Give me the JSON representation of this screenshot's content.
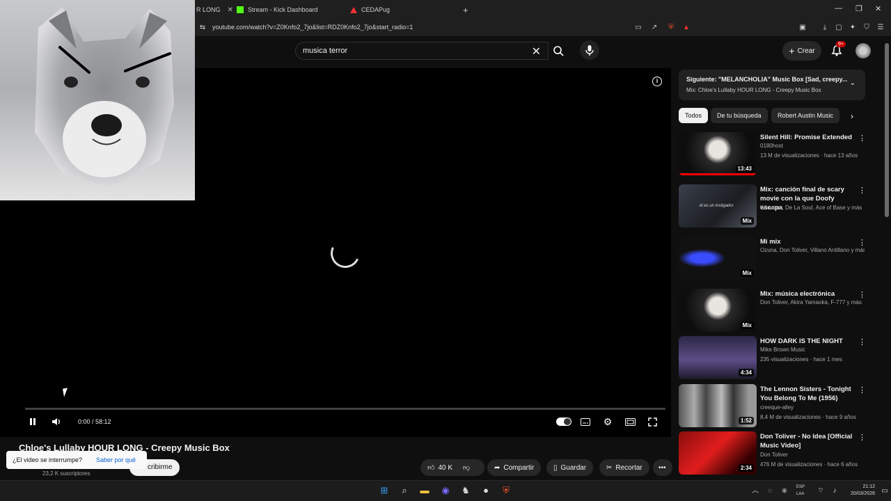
{
  "browser": {
    "tabs": [
      {
        "label": "R LONG"
      },
      {
        "label": "Stream - Kick Dashboard"
      },
      {
        "label": "CEDAPug"
      }
    ],
    "url": "youtube.com/watch?v=Z0Knfo2_7jo&list=RDZ0Knfo2_7jo&start_radio=1"
  },
  "header": {
    "search_value": "musica terror",
    "create_label": "Crear",
    "notif_count": "9+"
  },
  "player": {
    "time": "0:00 / 58:12"
  },
  "video": {
    "title": "Chloe's Lullaby HOUR LONG - Creepy Music Box",
    "subscribers": "23,2 K suscriptores",
    "subscribe_label": "cribirme",
    "toast_question": "¿El video se interrumpe?",
    "toast_link": "Saber por qué",
    "likes": "40 K",
    "share_label": "Compartir",
    "save_label": "Guardar",
    "clip_label": "Recortar"
  },
  "up_next": {
    "title": "Siguiente: \"MELANCHOLIA\" Music Box [Sad, creepy...",
    "subtitle": "Mix: Chloe's Lullaby HOUR LONG - Creepy Music Box"
  },
  "chips": [
    "Todos",
    "De tu búsqueda",
    "Robert Austin Music"
  ],
  "recommendations": [
    {
      "title": "Silent Hill: Promise Extended",
      "channel": "0180host",
      "meta": "13 M de visualizaciones · hace 13 años",
      "badge": "13:43"
    },
    {
      "title": "Mix: canción final de scary movie con la que Doofy escapa",
      "channel": "Wheatus, De La Soul, Ace of Base y más",
      "meta": "",
      "badge": "Mix",
      "thumb_text": "él es un instigador"
    },
    {
      "title": "Mi mix",
      "channel": "Ozuna, Don Toliver, Villano Antillano y más",
      "meta": "",
      "badge": "Mix"
    },
    {
      "title": "Mix: música electrónica",
      "channel": "Don Toliver, Akira Yamaoka, F-777 y más",
      "meta": "",
      "badge": "Mix"
    },
    {
      "title": "HOW DARK IS THE NIGHT",
      "channel": "Mike Brown Music",
      "meta": "235 visualizaciones · hace 1 mes",
      "badge": "4:34"
    },
    {
      "title": "The Lennon Sisters - Tonight You Belong To Me (1956)",
      "channel": "creeque-alley",
      "meta": "8,4 M de visualizaciones · hace 9 años",
      "badge": "1:52"
    },
    {
      "title": "Don Toliver - No Idea [Official Music Video]",
      "channel": "Don Toliver",
      "meta": "476 M de visualizaciones · hace 6 años",
      "badge": "2:34"
    }
  ],
  "taskbar": {
    "lang_line1": "ESP",
    "lang_line2": "LAA",
    "time": "21:12",
    "date": "20/03/2026"
  }
}
